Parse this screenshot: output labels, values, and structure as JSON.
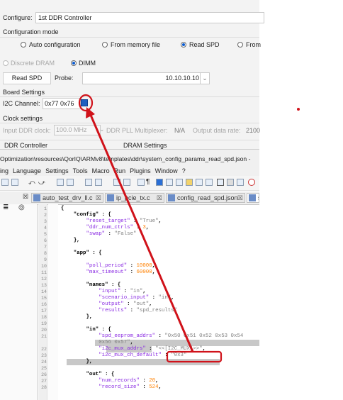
{
  "config": {
    "configure_label": "Configure:",
    "configure_value": "1st DDR Controller",
    "mode_label": "Configuration mode",
    "modes": [
      "Auto configuration",
      "From memory file",
      "Read SPD",
      "From"
    ],
    "selected_mode": "Read SPD",
    "dram": [
      "Discrete DRAM",
      "DIMM"
    ],
    "selected_dram": "DIMM",
    "read_spd_label": "Read SPD",
    "probe_label": "Probe:",
    "probe_value": "10.10.10.10",
    "board_settings_label": "Board Settings",
    "i2c_label": "I2C Channel:",
    "i2c_value": "0x77 0x76",
    "clock_settings_label": "Clock settings",
    "input_clock_label": "Input DDR clock:",
    "input_clock_value": "100.0 MHz",
    "pll_label": "DDR PLL Multiplexer:",
    "pll_value": "N/A",
    "output_rate_label": "Output data rate:",
    "output_rate_value": "2100",
    "ddr_controller_label": "DDR Controller",
    "dram_settings_label": "DRAM Settings"
  },
  "editor": {
    "path": "Optimization\\resources\\QorIQ\\ARMv8\\templates\\ddr\\system_config_params_read_spd.json -",
    "menu": [
      "ing",
      "Language",
      "Settings",
      "Tools",
      "Macro",
      "Run",
      "Plugins",
      "Window",
      "?"
    ],
    "tabs": [
      "auto_test_drv_ll.c",
      "ip_pcie_tx.c",
      "config_read_spd.json",
      "s"
    ],
    "panel_icons": [
      "≣",
      "◎"
    ]
  },
  "code_lines": [
    {
      "n": "1",
      "t": [
        [
          "p",
          "{"
        ]
      ]
    },
    {
      "n": "2",
      "t": [
        [
          "p",
          "    \"config\" : {"
        ]
      ]
    },
    {
      "n": "3",
      "t": [
        [
          "k",
          "        \"reset_target\""
        ],
        [
          "p",
          " : "
        ],
        [
          "s",
          "\"True\""
        ],
        [
          "p",
          ","
        ]
      ]
    },
    {
      "n": "4",
      "t": [
        [
          "k",
          "        \"ddr_num_ctrls\""
        ],
        [
          "p",
          " : "
        ],
        [
          "v",
          "3"
        ],
        [
          "p",
          ","
        ]
      ]
    },
    {
      "n": "5",
      "t": [
        [
          "k",
          "        \"swap\""
        ],
        [
          "p",
          " : "
        ],
        [
          "s",
          "\"False\""
        ]
      ]
    },
    {
      "n": "6",
      "t": [
        [
          "p",
          "    },"
        ]
      ]
    },
    {
      "n": "7",
      "t": [
        [
          "p",
          ""
        ]
      ]
    },
    {
      "n": "8",
      "t": [
        [
          "p",
          "    \"app\" : {"
        ]
      ]
    },
    {
      "n": "9",
      "t": [
        [
          "p",
          ""
        ]
      ]
    },
    {
      "n": "10",
      "t": [
        [
          "k",
          "        \"poll_period\""
        ],
        [
          "p",
          " : "
        ],
        [
          "v",
          "10000"
        ],
        [
          "p",
          ","
        ]
      ]
    },
    {
      "n": "11",
      "t": [
        [
          "k",
          "        \"max_timeout\""
        ],
        [
          "p",
          " : "
        ],
        [
          "v",
          "60000"
        ],
        [
          "p",
          ","
        ]
      ]
    },
    {
      "n": "12",
      "t": [
        [
          "p",
          ""
        ]
      ]
    },
    {
      "n": "13",
      "t": [
        [
          "p",
          "        \"names\" : {"
        ]
      ]
    },
    {
      "n": "14",
      "t": [
        [
          "k",
          "            \"input\""
        ],
        [
          "p",
          " : "
        ],
        [
          "s",
          "\"in\""
        ],
        [
          "p",
          ","
        ]
      ]
    },
    {
      "n": "15",
      "t": [
        [
          "k",
          "            \"scenario_input\""
        ],
        [
          "p",
          " : "
        ],
        [
          "s",
          "\"in\""
        ],
        [
          "p",
          ","
        ]
      ]
    },
    {
      "n": "16",
      "t": [
        [
          "k",
          "            \"output\""
        ],
        [
          "p",
          " : "
        ],
        [
          "s",
          "\"out\""
        ],
        [
          "p",
          ","
        ]
      ]
    },
    {
      "n": "17",
      "t": [
        [
          "k",
          "            \"results\""
        ],
        [
          "p",
          " : "
        ],
        [
          "s",
          "\"spd_results\""
        ]
      ]
    },
    {
      "n": "18",
      "t": [
        [
          "p",
          "        },"
        ]
      ]
    },
    {
      "n": "19",
      "t": [
        [
          "p",
          ""
        ]
      ]
    },
    {
      "n": "20",
      "t": [
        [
          "p",
          "        \"in\" : {"
        ]
      ]
    },
    {
      "n": "21",
      "t": [
        [
          "k",
          "            \"spd_eeprom_addrs\""
        ],
        [
          "p",
          " : "
        ],
        [
          "s",
          "\"0x50 0x51 0x52 0x53 0x54"
        ]
      ]
    },
    {
      "n": "",
      "t": [
        [
          "s",
          "            0x56 0x57\""
        ],
        [
          "p",
          ","
        ]
      ]
    },
    {
      "n": "22",
      "t": [
        [
          "k",
          "            \"i2c_mux_addrs\""
        ],
        [
          "p",
          " : "
        ],
        [
          "s",
          "\"<<[I2C_MUX]>>\""
        ],
        [
          "p",
          ","
        ]
      ]
    },
    {
      "n": "23",
      "t": [
        [
          "k",
          "            \"i2c_mux_ch_default\""
        ],
        [
          "p",
          " : "
        ],
        [
          "s",
          "\"0x3\""
        ]
      ]
    },
    {
      "n": "24",
      "t": [
        [
          "p",
          "        },"
        ]
      ]
    },
    {
      "n": "25",
      "t": [
        [
          "p",
          ""
        ]
      ]
    },
    {
      "n": "26",
      "t": [
        [
          "p",
          "        \"out\" : {"
        ]
      ]
    },
    {
      "n": "27",
      "t": [
        [
          "k",
          "            \"num_records\""
        ],
        [
          "p",
          " : "
        ],
        [
          "v",
          "20"
        ],
        [
          "p",
          ","
        ]
      ]
    },
    {
      "n": "28",
      "t": [
        [
          "k",
          "            \"record_size\""
        ],
        [
          "p",
          " : "
        ],
        [
          "v",
          "524"
        ],
        [
          "p",
          ","
        ]
      ]
    }
  ],
  "colors": {
    "annotation": "#d0121a",
    "accent": "#0a5bd0"
  }
}
